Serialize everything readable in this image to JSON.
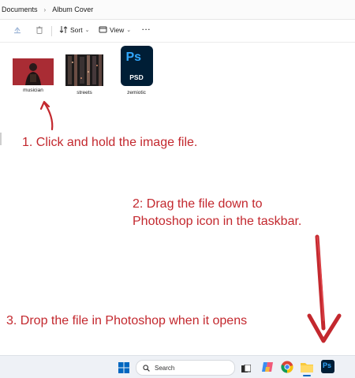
{
  "breadcrumb": [
    "Documents",
    "Album Cover"
  ],
  "toolbar": {
    "sort_label": "Sort",
    "view_label": "View",
    "more_label": "···"
  },
  "files": [
    {
      "name": "musician"
    },
    {
      "name": "streets"
    },
    {
      "name": "zemiotic",
      "badge_top": "Ps",
      "badge_bottom": "PSD"
    }
  ],
  "instructions": {
    "step1": "1. Click and hold the image file.",
    "step2_line1": "2: Drag the file down to",
    "step2_line2": "Photoshop icon in the taskbar.",
    "step3": "3. Drop the file in Photoshop when it opens"
  },
  "taskbar": {
    "search_label": "Search",
    "photoshop_badge": "Ps"
  },
  "colors": {
    "accent_red": "#c3282e",
    "photoshop_blue": "#31a8ff",
    "photoshop_bg": "#001e36",
    "windows_blue": "#0067c0"
  }
}
